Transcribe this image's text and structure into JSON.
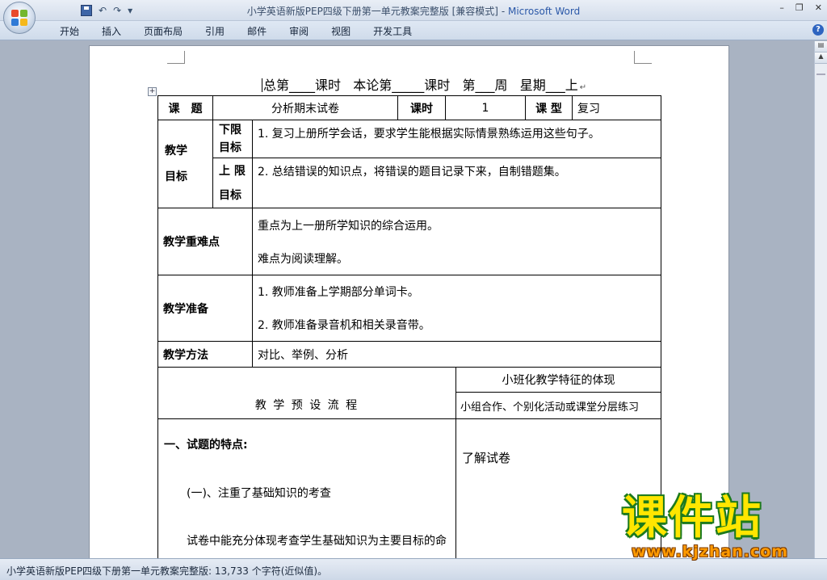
{
  "window": {
    "title": "小学英语新版PEP四级下册第一单元教案完整版 [兼容模式]",
    "title_sep": " - ",
    "app_name": "Microsoft Word"
  },
  "quick_access": {
    "undo": "↶",
    "redo": "↷",
    "customize": "▾"
  },
  "window_controls": {
    "minimize": "–",
    "restore": "❐",
    "close": "✕"
  },
  "ribbon": {
    "tabs": [
      "开始",
      "插入",
      "页面布局",
      "引用",
      "邮件",
      "审阅",
      "视图",
      "开发工具"
    ],
    "help": "?"
  },
  "document": {
    "heading": "总第____课时   本论第_____课时   第___周   星期___上",
    "para_mark": "↵",
    "table": {
      "r1": {
        "label": "课　题",
        "topic": "分析期末试卷",
        "period_label": "课时",
        "period_value": "1",
        "type_label": "课 型",
        "type_value": "复习"
      },
      "goals": {
        "label": "教学目标",
        "lower_label": "下限目标",
        "lower_text": "1. 复习上册所学会话，要求学生能根据实际情景熟练运用这些句子。",
        "upper_label": "上 限 目标",
        "upper_text": "2. 总结错误的知识点，将错误的题目记录下来，自制错题集。"
      },
      "key": {
        "label": "教学重难点",
        "line1": "重点为上一册所学知识的综合运用。",
        "line2": "难点为阅读理解。"
      },
      "prep": {
        "label": "教学准备",
        "line1": "1. 教师准备上学期部分单词卡。",
        "line2": "2. 教师准备录音机和相关录音带。"
      },
      "method": {
        "label": "教学方法",
        "text": "对比、举例、分析"
      },
      "flow": {
        "title": "教 学 预 设 流 程",
        "feature_title": "小班化教学特征的体现",
        "feature_sub": "小组合作、个别化活动或课堂分层练习",
        "section1": "一、试题的特点:",
        "sub1": "(一)、注重了基础知识的考查",
        "body1": "试卷中能充分体现考查学生基础知识为主要目标的命",
        "right1": "了解试卷"
      }
    }
  },
  "status": {
    "text": "小学英语新版PEP四级下册第一单元教案完整版: 13,733 个字符(近似值)。"
  },
  "watermark": {
    "brand": "课件站",
    "url": "www.kjzhan.com"
  }
}
